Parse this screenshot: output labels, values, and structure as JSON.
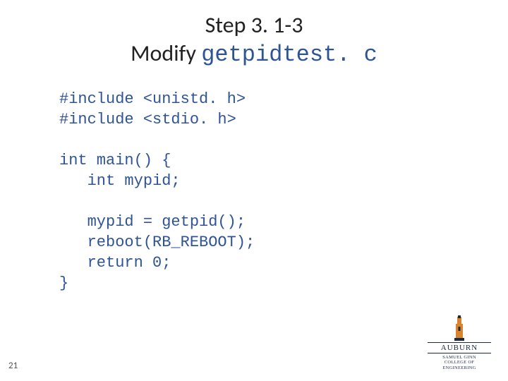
{
  "title": {
    "step": "Step 3. 1-3",
    "modify_prefix": "Modify ",
    "filename": "getpidtest. c"
  },
  "code": {
    "lines": [
      "#include <unistd. h>",
      "#include <stdio. h>",
      "",
      "int main() {",
      "   int mypid;",
      "",
      "   mypid = getpid();",
      "   reboot(RB_REBOOT);",
      "   return 0;",
      "}"
    ]
  },
  "page_number": "21",
  "logo": {
    "university": "AUBURN",
    "sub1": "SAMUEL GINN",
    "sub2": "COLLEGE OF ENGINEERING"
  }
}
